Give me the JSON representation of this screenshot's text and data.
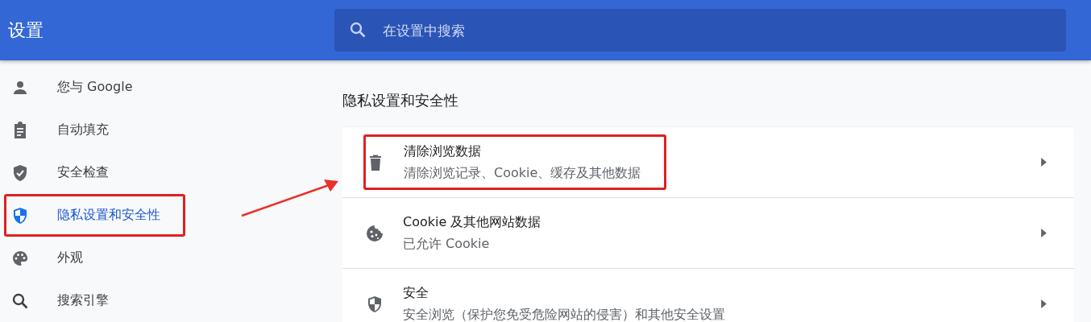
{
  "header": {
    "title": "设置",
    "search": {
      "placeholder": "在设置中搜索"
    }
  },
  "sidebar": {
    "items": [
      {
        "kind": "person",
        "label": "您与 Google",
        "selected": false,
        "highlighted": false
      },
      {
        "kind": "clipboard",
        "label": "自动填充",
        "selected": false,
        "highlighted": false
      },
      {
        "kind": "shield-check",
        "label": "安全检查",
        "selected": false,
        "highlighted": false
      },
      {
        "kind": "shield-half",
        "label": "隐私设置和安全性",
        "selected": true,
        "highlighted": true
      },
      {
        "kind": "palette",
        "label": "外观",
        "selected": false,
        "highlighted": false
      },
      {
        "kind": "search",
        "label": "搜索引擎",
        "selected": false,
        "highlighted": false
      }
    ]
  },
  "section": {
    "title": "隐私设置和安全性",
    "rows": [
      {
        "kind": "trash",
        "title": "清除浏览数据",
        "subtitle": "清除浏览记录、Cookie、缓存及其他数据",
        "highlighted": true
      },
      {
        "kind": "cookie",
        "title": "Cookie 及其他网站数据",
        "subtitle": "已允许 Cookie",
        "highlighted": false
      },
      {
        "kind": "shield-half",
        "title": "安全",
        "subtitle": "安全浏览（保护您免受危险网站的侵害）和其他安全设置",
        "highlighted": false
      }
    ]
  }
}
